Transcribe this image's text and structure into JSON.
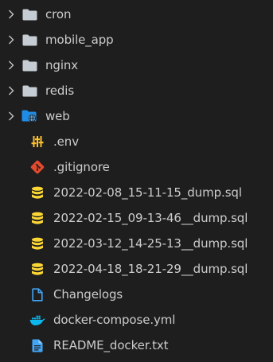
{
  "explorer": {
    "folders": [
      {
        "label": "cron",
        "icon": "folder-icon"
      },
      {
        "label": "mobile_app",
        "icon": "folder-icon"
      },
      {
        "label": "nginx",
        "icon": "folder-icon"
      },
      {
        "label": "redis",
        "icon": "folder-icon"
      },
      {
        "label": "web",
        "icon": "web-folder-icon"
      }
    ],
    "files": [
      {
        "label": ".env",
        "icon": "env-settings-icon"
      },
      {
        "label": ".gitignore",
        "icon": "git-icon"
      },
      {
        "label": "2022-02-08_15-11-15_dump.sql",
        "icon": "database-icon"
      },
      {
        "label": "2022-02-15_09-13-46__dump.sql",
        "icon": "database-icon"
      },
      {
        "label": "2022-03-12_14-25-13__dump.sql",
        "icon": "database-icon"
      },
      {
        "label": "2022-04-18_18-21-29__dump.sql",
        "icon": "database-icon"
      },
      {
        "label": "Changelogs",
        "icon": "document-icon"
      },
      {
        "label": "docker-compose.yml",
        "icon": "docker-icon"
      },
      {
        "label": "README_docker.txt",
        "icon": "text-file-icon"
      }
    ]
  },
  "colors": {
    "background": "#1e1e1e",
    "text": "#cccccc",
    "folder": "#c5ccd3",
    "web_folder": "#1f8de6",
    "env": "#fbc02d",
    "git": "#e44a2d",
    "database": "#fdd835",
    "document": "#42a5f5",
    "docker": "#0db7ed",
    "text_file": "#42a5f5"
  }
}
